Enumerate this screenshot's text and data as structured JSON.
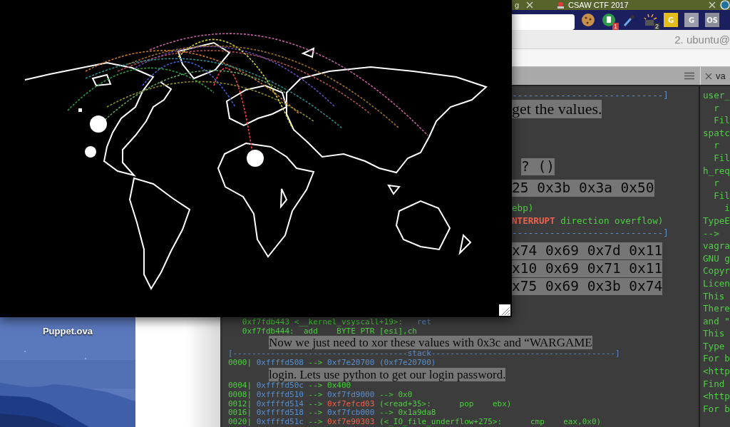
{
  "browser": {
    "tabs": [
      {
        "title": "g"
      },
      {
        "title": "CSAW CTF 2017"
      }
    ],
    "extensions": [
      {
        "kind": "cookie"
      },
      {
        "kind": "round",
        "badge": "1"
      },
      {
        "kind": "dropper"
      },
      {
        "kind": "rays",
        "badge": "2"
      },
      {
        "kind": "tile",
        "label": "G",
        "color": "#e3bd1c"
      },
      {
        "kind": "tile",
        "label": "G",
        "color": "#9b9da8"
      },
      {
        "kind": "tile",
        "label": "OS",
        "color": "#8c8e98"
      }
    ]
  },
  "terminal": {
    "title": "2. ubuntu@",
    "pane_tab": "va",
    "upper_top": [
      {
        "segments": [
          {
            "text": "----------------------------]",
            "kind": "blue"
          }
        ]
      }
    ],
    "upper_bottom": [
      {
        "segments": [
          {
            "text": "ebp)",
            "kind": "green"
          }
        ]
      },
      {
        "segments": [
          {
            "text": "NTERRUPT",
            "kind": "alert"
          },
          {
            "text": " direction overflow)",
            "kind": "green"
          }
        ]
      },
      {
        "segments": [
          {
            "text": "----------------------------]",
            "kind": "blue"
          }
        ]
      }
    ],
    "lower": [
      {
        "segments": [
          {
            "text": "   0xf7fdb443 <__kernel_vsyscall+19>:   ",
            "kind": "green"
          },
          {
            "text": "ret",
            "kind": "blue"
          }
        ]
      },
      {
        "segments": [
          {
            "text": "   0xf7fdb444:  add    BYTE PTR [esi],ch",
            "kind": "green"
          }
        ]
      },
      {
        "segments": [
          {
            "text": "[-------------------------------------stack---------------------------------------]",
            "kind": "blue"
          }
        ]
      },
      {
        "segments": [
          {
            "text": "0000| ",
            "kind": "green"
          },
          {
            "text": "0xffffd508",
            "kind": "blue"
          },
          {
            "text": " --> ",
            "kind": "green"
          },
          {
            "text": "0xf7e20700 (0xf7e20700)",
            "kind": "blue"
          }
        ]
      },
      {
        "segments": [
          {
            "text": "0004| ",
            "kind": "green"
          },
          {
            "text": "0xffffd50c",
            "kind": "blue"
          },
          {
            "text": " --> 0x400",
            "kind": "green"
          }
        ]
      },
      {
        "segments": [
          {
            "text": "0008| ",
            "kind": "green"
          },
          {
            "text": "0xffffd510",
            "kind": "blue"
          },
          {
            "text": " --> ",
            "kind": "green"
          },
          {
            "text": "0xf7fd9000",
            "kind": "blue"
          },
          {
            "text": " --> 0x0",
            "kind": "green"
          }
        ]
      },
      {
        "segments": [
          {
            "text": "0012| ",
            "kind": "green"
          },
          {
            "text": "0xffffd514",
            "kind": "blue"
          },
          {
            "text": " --> ",
            "kind": "green"
          },
          {
            "text": "0xf7efcd03",
            "kind": "red"
          },
          {
            "text": " (<read+35>:      pop    ebx)",
            "kind": "green"
          }
        ]
      },
      {
        "segments": [
          {
            "text": "0016| ",
            "kind": "green"
          },
          {
            "text": "0xffffd518",
            "kind": "blue"
          },
          {
            "text": " --> ",
            "kind": "green"
          },
          {
            "text": "0xf7fcb000",
            "kind": "blue"
          },
          {
            "text": " --> 0x1a9da8",
            "kind": "green"
          }
        ]
      },
      {
        "segments": [
          {
            "text": "0020| ",
            "kind": "green"
          },
          {
            "text": "0xffffd51c",
            "kind": "blue"
          },
          {
            "text": " --> ",
            "kind": "green"
          },
          {
            "text": "0xf7e90303",
            "kind": "red"
          },
          {
            "text": " (<_IO_file_underflow+275>:      cmp    eax,0x0)",
            "kind": "green"
          }
        ]
      }
    ],
    "right_lines": [
      "user_",
      "  r",
      "  Fil",
      "spatc",
      "  r",
      "  Fil",
      "h_req",
      "  r",
      "  Fil",
      "    i",
      "TypeE",
      "-->",
      "vagra",
      "GNU g",
      "Copyr",
      "Licen",
      "This",
      "There",
      "and \"",
      "This",
      "Type",
      "For b",
      "<http",
      "Find",
      "<http",
      "For b"
    ]
  },
  "blog_overlay": [
    {
      "text": "get the values.",
      "kind": "prose"
    },
    {
      "text": "? ()",
      "kind": "code"
    },
    {
      "text": "25 0x3b 0x3a 0x50",
      "kind": "code"
    },
    {
      "text": "x74 0x69 0x7d 0x11",
      "kind": "code"
    },
    {
      "text": "x10 0x69 0x71 0x11",
      "kind": "code"
    },
    {
      "text": "x75 0x69 0x3b 0x74",
      "kind": "code"
    },
    {
      "text": "Now we just need to xor these values with 0x3c and “WARGAME",
      "kind": "prose"
    },
    {
      "text": "login. Lets use python to get our login password.",
      "kind": "prose"
    }
  ],
  "desktop_icon": {
    "label": "Puppet.ova"
  }
}
